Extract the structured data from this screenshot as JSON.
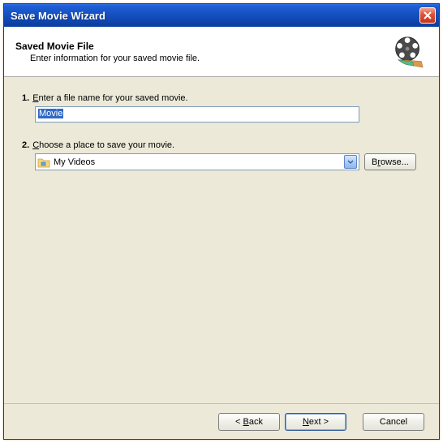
{
  "window": {
    "title": "Save Movie Wizard"
  },
  "header": {
    "title": "Saved Movie File",
    "subtitle": "Enter information for your saved movie file."
  },
  "step1": {
    "num": "1.",
    "label_pre": "",
    "label_u": "E",
    "label_post": "nter a file name for your saved movie.",
    "value": "Movie"
  },
  "step2": {
    "num": "2.",
    "label_pre": "",
    "label_u": "C",
    "label_post": "hoose a place to save your movie.",
    "selected": "My Videos",
    "browse_pre": "B",
    "browse_u": "r",
    "browse_post": "owse..."
  },
  "footer": {
    "back_lt": "< ",
    "back_u": "B",
    "back_post": "ack",
    "next_u": "N",
    "next_post": "ext >",
    "cancel": "Cancel"
  }
}
